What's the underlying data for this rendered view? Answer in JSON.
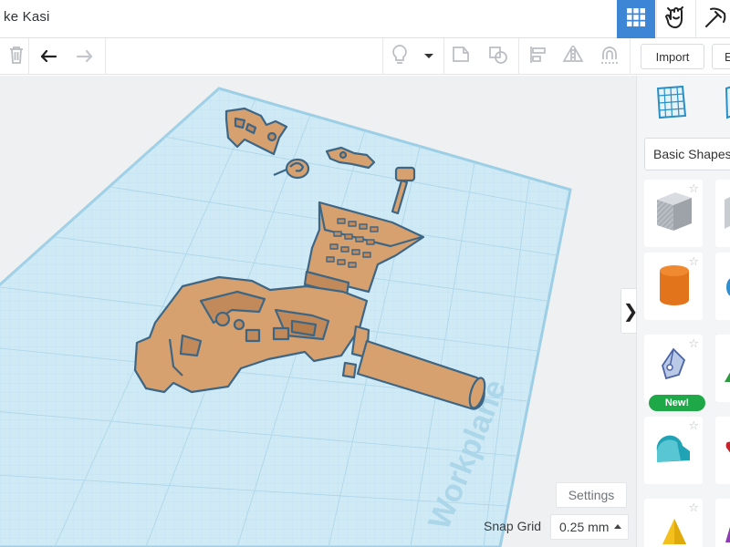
{
  "app": {
    "title": "ke Kasi"
  },
  "topbar": {
    "buttons": [
      {
        "name": "3d-design-grid-icon",
        "active": true
      },
      {
        "name": "codeblocks-hand-icon",
        "active": false
      },
      {
        "name": "pickaxe-icon",
        "active": false
      }
    ]
  },
  "toolbar": {
    "import_label": "Import",
    "export_label": "E",
    "tools": [
      "trash-icon",
      "undo-icon",
      "redo-icon",
      "lightbulb-icon",
      "dropdown-icon",
      "group-icon",
      "ungroup-icon",
      "align-icon",
      "mirror-icon",
      "cruise-icon"
    ]
  },
  "workspace": {
    "workplane_label": "Workplane",
    "settings_label": "Settings",
    "snap_grid_label": "Snap Grid",
    "snap_grid_value": "0.25 mm",
    "collapse_glyph": "❯"
  },
  "panel": {
    "category_label": "Basic Shapes",
    "new_badge": "New!",
    "shapes": [
      "workplane-icon",
      "ruler-icon",
      "box-icon",
      "cylinder-icon",
      "pen-tool-icon",
      "roof-icon",
      "pyramid-icon"
    ]
  },
  "colors": {
    "accent": "#3d86d6",
    "workplane_fill": "#cfe9f5",
    "workplane_border": "#9ccfe6",
    "part_fill": "#d7a06f",
    "part_outline": "#3d6685",
    "new_badge": "#1ea848"
  }
}
